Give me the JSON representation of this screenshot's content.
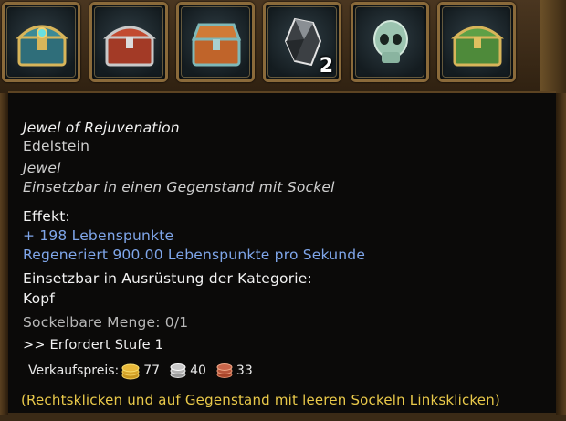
{
  "inventory": {
    "slots": [
      {
        "icon": "teal-chest-icon"
      },
      {
        "icon": "red-chest-icon"
      },
      {
        "icon": "orange-chest-icon"
      },
      {
        "icon": "rough-crystal-icon",
        "count": "2"
      },
      {
        "icon": "skull-icon"
      },
      {
        "icon": "green-chest-icon"
      }
    ]
  },
  "tooltip": {
    "name": "Jewel of Rejuvenation",
    "category": "Edelstein",
    "subcategory": "Jewel",
    "usage": "Einsetzbar in einen Gegenstand mit Sockel",
    "effect_heading": "Effekt:",
    "effects": [
      "+ 198 Lebenspunkte",
      "Regeneriert 900.00 Lebenspunkte pro Sekunde"
    ],
    "equip_heading": "Einsetzbar in Ausrüstung der Kategorie:",
    "equip_category": "Kopf",
    "socket_amount": "Sockelbare Menge: 0/1",
    "level_req": ">> Erfordert Stufe 1",
    "price": {
      "label": "Verkaufspreis:",
      "gold": "77",
      "silver": "40",
      "copper": "33"
    },
    "hint": "(Rechtsklicken und auf Gegenstand mit leeren Sockeln Linksklicken)"
  },
  "colors": {
    "text_white": "#f2f2f2",
    "effect_blue": "#7fa6ea",
    "hint_yellow": "#e9c94a",
    "tooltip_bg": "#0b0a09"
  }
}
